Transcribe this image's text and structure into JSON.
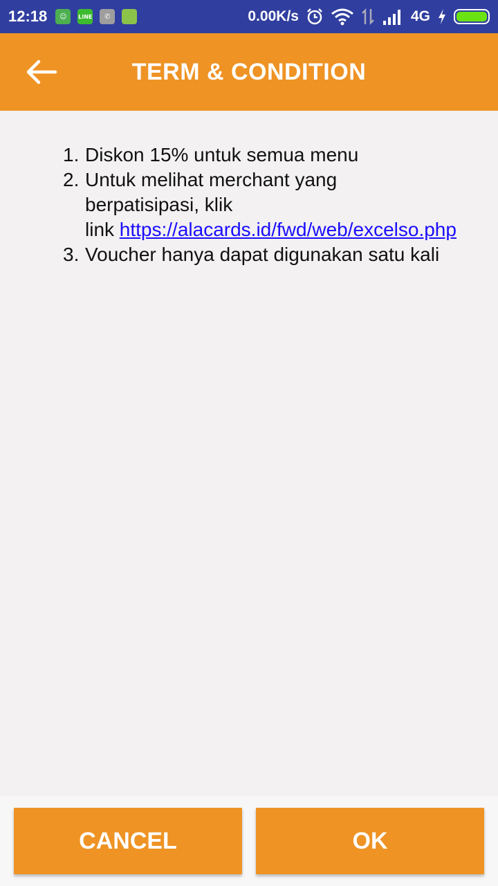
{
  "status_bar": {
    "time": "12:18",
    "net_speed": "0.00K/s",
    "network_type": "4G",
    "icons": [
      "android-icon",
      "line-icon",
      "whatsapp-icon",
      "battery-app-icon",
      "alarm-icon",
      "wifi-icon",
      "data-arrows-icon",
      "signal-icon",
      "charging-icon",
      "battery-icon"
    ]
  },
  "app_bar": {
    "title": "TERM & CONDITION",
    "back_icon": "arrow-left-icon",
    "background_color": "#ee9324"
  },
  "terms": {
    "items": [
      {
        "number": "1.",
        "text": "Diskon 15% untuk semua menu"
      },
      {
        "number": "2.",
        "text_line1": "Untuk melihat merchant yang",
        "text_line2": "berpatisipasi, klik",
        "text_link_prefix": "link ",
        "link": "https://alacards.id/fwd/web/excelso.php"
      },
      {
        "number": "3.",
        "text": "Voucher hanya dapat digunakan satu kali"
      }
    ]
  },
  "actions": {
    "cancel_label": "CANCEL",
    "ok_label": "OK"
  },
  "colors": {
    "status_bar": "#303f9f",
    "accent": "#ee9324",
    "link": "#1a0dff"
  }
}
